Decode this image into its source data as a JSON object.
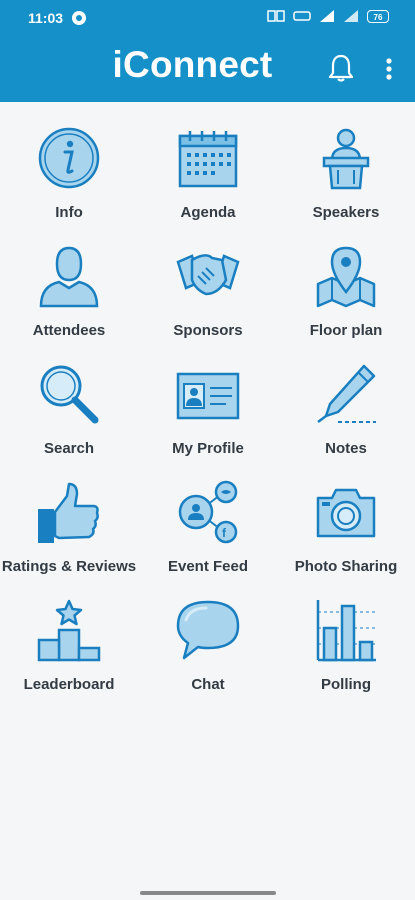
{
  "status": {
    "time": "11:03",
    "battery": "76"
  },
  "app": {
    "title": "iConnect"
  },
  "tiles": [
    {
      "label": "Info",
      "icon": "info-icon"
    },
    {
      "label": "Agenda",
      "icon": "calendar-icon"
    },
    {
      "label": "Speakers",
      "icon": "speaker-podium-icon"
    },
    {
      "label": "Attendees",
      "icon": "person-icon"
    },
    {
      "label": "Sponsors",
      "icon": "handshake-icon"
    },
    {
      "label": "Floor plan",
      "icon": "map-pin-icon"
    },
    {
      "label": "Search",
      "icon": "search-icon"
    },
    {
      "label": "My Profile",
      "icon": "id-card-icon"
    },
    {
      "label": "Notes",
      "icon": "pen-icon"
    },
    {
      "label": "Ratings & Reviews",
      "icon": "thumbs-up-icon"
    },
    {
      "label": "Event Feed",
      "icon": "social-feed-icon"
    },
    {
      "label": "Photo Sharing",
      "icon": "camera-icon"
    },
    {
      "label": "Leaderboard",
      "icon": "podium-star-icon"
    },
    {
      "label": "Chat",
      "icon": "speech-bubble-icon"
    },
    {
      "label": "Polling",
      "icon": "bar-chart-icon"
    }
  ],
  "colors": {
    "header": "#1590c9",
    "icon_fill": "#a9d4ee",
    "icon_stroke": "#1a7fc1",
    "label": "#333c44",
    "background": "#f4f6f7"
  }
}
